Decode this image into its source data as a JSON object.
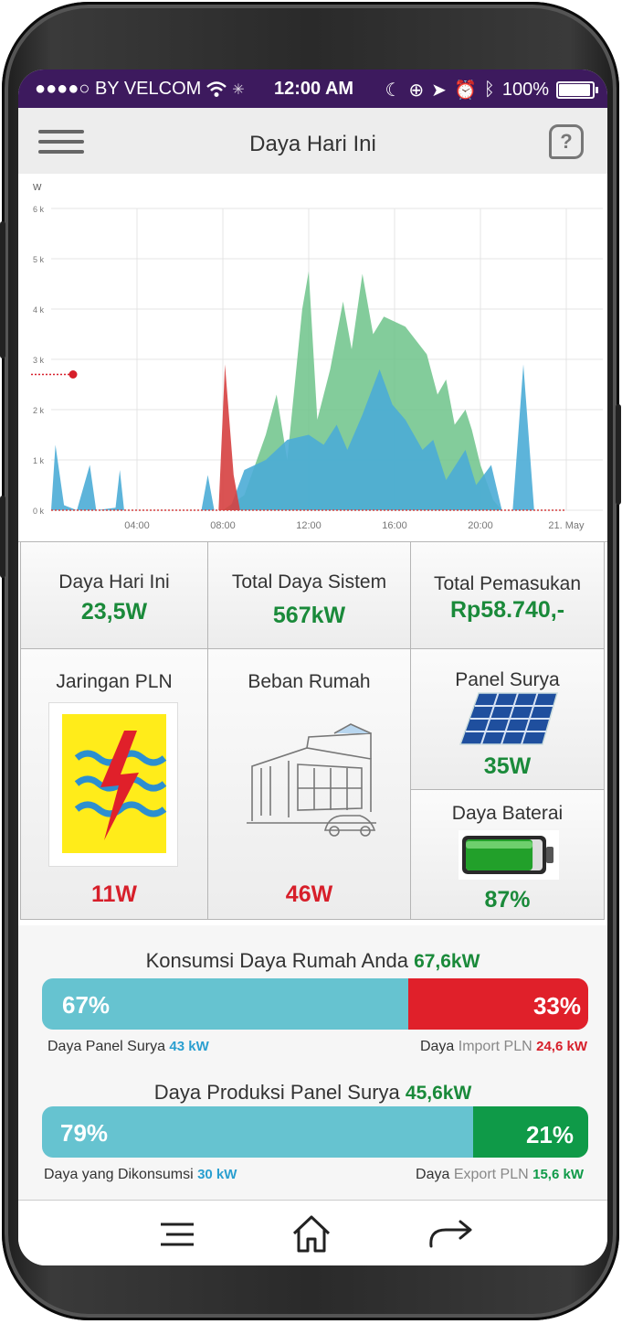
{
  "status_bar": {
    "carrier": "●●●●○ BY VELCOM",
    "time": "12:00 AM",
    "battery": "100%"
  },
  "header": {
    "title": "Daya Hari Ini",
    "help_icon": "question-icon",
    "menu_icon": "hamburger-icon"
  },
  "chart_data": {
    "type": "area",
    "ylabel": "W",
    "y_ticks": [
      "0 k",
      "1 k",
      "2 k",
      "3 k",
      "4 k",
      "5 k",
      "6 k"
    ],
    "x_ticks": [
      "04:00",
      "08:00",
      "12:00",
      "16:00",
      "20:00",
      "21. May"
    ],
    "ylim": [
      0,
      6000
    ],
    "xlim_hours": [
      0,
      24
    ],
    "grid": true,
    "series": [
      {
        "color": "#6dc38a",
        "points": [
          [
            7,
            0
          ],
          [
            8,
            0
          ],
          [
            9,
            300
          ],
          [
            10,
            1500
          ],
          [
            10.5,
            2300
          ],
          [
            11,
            1000
          ],
          [
            11.7,
            4000
          ],
          [
            12,
            4750
          ],
          [
            12.4,
            1800
          ],
          [
            13,
            2800
          ],
          [
            13.6,
            4150
          ],
          [
            14,
            3200
          ],
          [
            14.5,
            4700
          ],
          [
            15,
            3500
          ],
          [
            15.5,
            3850
          ],
          [
            16.5,
            3650
          ],
          [
            17.5,
            3100
          ],
          [
            18,
            2300
          ],
          [
            18.4,
            2600
          ],
          [
            18.8,
            1700
          ],
          [
            19.3,
            2000
          ],
          [
            19.6,
            1600
          ],
          [
            20,
            900
          ],
          [
            20.6,
            200
          ],
          [
            21,
            0
          ]
        ]
      },
      {
        "color": "#4bacd6",
        "points": [
          [
            0,
            0
          ],
          [
            0.2,
            1300
          ],
          [
            0.6,
            100
          ],
          [
            1.2,
            0
          ],
          [
            1.8,
            900
          ],
          [
            2.1,
            0
          ],
          [
            3,
            50
          ],
          [
            3.2,
            800
          ],
          [
            3.4,
            0
          ],
          [
            7,
            0
          ],
          [
            7.3,
            700
          ],
          [
            7.6,
            0
          ],
          [
            8.3,
            0
          ],
          [
            9,
            800
          ],
          [
            10,
            1000
          ],
          [
            11,
            1400
          ],
          [
            12,
            1500
          ],
          [
            12.7,
            1300
          ],
          [
            13.3,
            1700
          ],
          [
            13.8,
            1200
          ],
          [
            14.5,
            1900
          ],
          [
            15.3,
            2800
          ],
          [
            15.9,
            2100
          ],
          [
            16.5,
            1800
          ],
          [
            17.3,
            1200
          ],
          [
            17.8,
            1400
          ],
          [
            18.4,
            600
          ],
          [
            19,
            1000
          ],
          [
            19.3,
            1200
          ],
          [
            19.8,
            500
          ],
          [
            20.5,
            900
          ],
          [
            21,
            0
          ],
          [
            21.5,
            0
          ],
          [
            22,
            2900
          ],
          [
            22.5,
            0
          ]
        ]
      },
      {
        "color": "#d64040",
        "points": [
          [
            7.8,
            0
          ],
          [
            8.1,
            2900
          ],
          [
            8.5,
            700
          ],
          [
            8.8,
            0
          ]
        ]
      }
    ],
    "marker": {
      "y": 2700,
      "color": "#d71f2a"
    }
  },
  "stats": {
    "daya_hari_ini": {
      "label": "Daya Hari Ini",
      "value": "23,5W"
    },
    "total_daya_sistem": {
      "label": "Total Daya Sistem",
      "value": "567kW"
    },
    "total_pemasukan": {
      "label": "Total Pemasukan",
      "value": "Rp58.740,-"
    },
    "jaringan_pln": {
      "label": "Jaringan PLN",
      "value": "11W",
      "icon": "pln-logo-icon"
    },
    "beban_rumah": {
      "label": "Beban Rumah",
      "value": "46W",
      "icon": "house-icon"
    },
    "panel_surya": {
      "label": "Panel Surya",
      "value": "35W",
      "icon": "solar-panel-icon"
    },
    "daya_baterai": {
      "label": "Daya Baterai",
      "value": "87%",
      "icon": "battery-icon",
      "level": 0.87
    }
  },
  "konsumsi": {
    "title": "Konsumsi Daya Rumah Anda",
    "total": "67,6kW",
    "left_pct": "67%",
    "right_pct": "33%",
    "left_fraction": 0.67,
    "left_label": "Daya Panel Surya",
    "left_value": "43 kW",
    "right_label_a": "Daya",
    "right_label_b": "Import PLN",
    "right_value": "24,6 kW",
    "left_color": "#66c3d0",
    "right_color": "#e0202a"
  },
  "produksi": {
    "title": "Daya Produksi Panel Surya",
    "total": "45,6kW",
    "left_pct": "79%",
    "right_pct": "21%",
    "left_fraction": 0.79,
    "left_label": "Daya yang Dikonsumsi",
    "left_value": "30 kW",
    "right_label_a": "Daya",
    "right_label_b": "Export PLN",
    "right_value": "15,6 kW",
    "left_color": "#66c3d0",
    "right_color": "#0f9a48"
  },
  "navbar": {
    "menu_icon": "menu-icon",
    "home_icon": "home-icon",
    "share_icon": "share-arrow-icon"
  }
}
